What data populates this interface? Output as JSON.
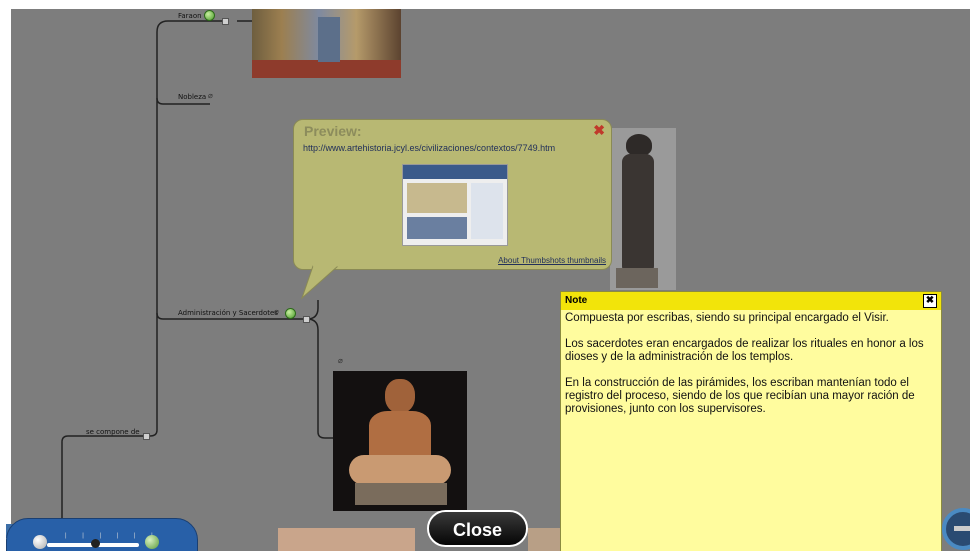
{
  "map_nodes": {
    "faraon": "Faraon",
    "nobleza": "Nobleza",
    "administracion": "Administración y Sacerdotes",
    "se_compone": "se compone de"
  },
  "preview": {
    "title": "Preview:",
    "close_glyph": "✖",
    "url": "http://www.artehistoria.jcyl.es/civilizaciones/contextos/7749.htm",
    "about_link": "About Thumbshots thumbnails"
  },
  "note": {
    "title": "Note",
    "close_glyph": "✖",
    "paragraphs": [
      "Compuesta por escribas, siendo su principal encargado el Visir.",
      "Los sacerdotes eran encargados de realizar los rituales en honor a los dioses y de la administración de los templos.",
      "En la construcción de las pirámides, los escriban mantenían todo el registro del proceso, siendo de los que recibían una mayor ración de provisiones, junto con los supervisores."
    ]
  },
  "close_button": {
    "label": "Close"
  },
  "zoom": {
    "ticks": "| | | | | |"
  },
  "icons": {
    "attachment": "⌀"
  },
  "colors": {
    "overlay": "#7d7d7d",
    "note_header": "#f2e40a",
    "note_body": "#fffc9e",
    "preview_bg": "#b8b873",
    "zoom_bg": "#2860a8"
  }
}
